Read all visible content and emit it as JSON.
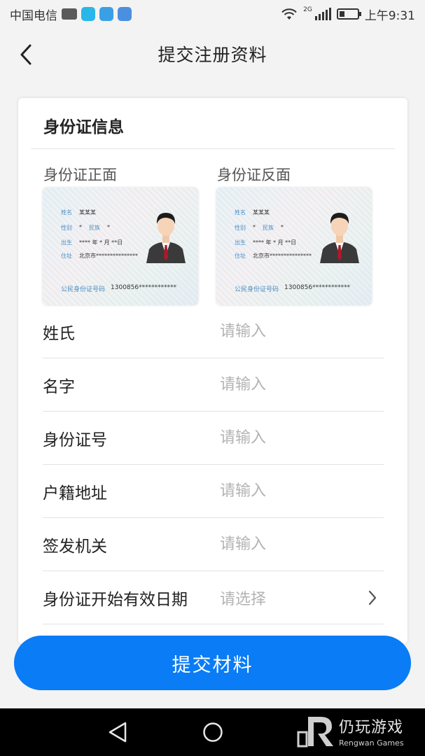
{
  "status_bar": {
    "carrier": "中国电信",
    "network": "2G",
    "time": "上午9:31",
    "battery_level": 0.3
  },
  "header": {
    "title": "提交注册资料"
  },
  "id_section": {
    "title": "身份证信息",
    "front_label": "身份证正面",
    "back_label": "身份证反面",
    "sample_card": {
      "name_key": "姓名",
      "name_value": "某某某",
      "gender_key": "性别",
      "gender_value": "*",
      "ethnicity_key": "民族",
      "ethnicity_value": "*",
      "birth_key": "出生",
      "birth_value": "**** 年 * 月 **日",
      "address_key": "住址",
      "address_value": "北京市***************",
      "id_key": "公民身份证号码",
      "id_value": "1300856************"
    }
  },
  "form": {
    "fields": [
      {
        "label": "姓氏",
        "placeholder": "请输入"
      },
      {
        "label": "名字",
        "placeholder": "请输入"
      },
      {
        "label": "身份证号",
        "placeholder": "请输入"
      },
      {
        "label": "户籍地址",
        "placeholder": "请输入"
      },
      {
        "label": "签发机关",
        "placeholder": "请输入"
      },
      {
        "label": "身份证开始有效日期",
        "placeholder": "请选择"
      }
    ]
  },
  "submit_button": {
    "label": "提交材料"
  },
  "watermark": {
    "name_cn": "仍玩游戏",
    "name_en": "Rengwan Games"
  },
  "colors": {
    "accent": "#0a7cf6",
    "background": "#f3f3f3",
    "placeholder": "#b3b3b3"
  },
  "icons": {
    "back": "back-arrow-icon",
    "chevron": "chevron-right-icon",
    "nav_back": "nav-back-triangle-icon",
    "nav_home": "nav-home-circle-icon"
  }
}
